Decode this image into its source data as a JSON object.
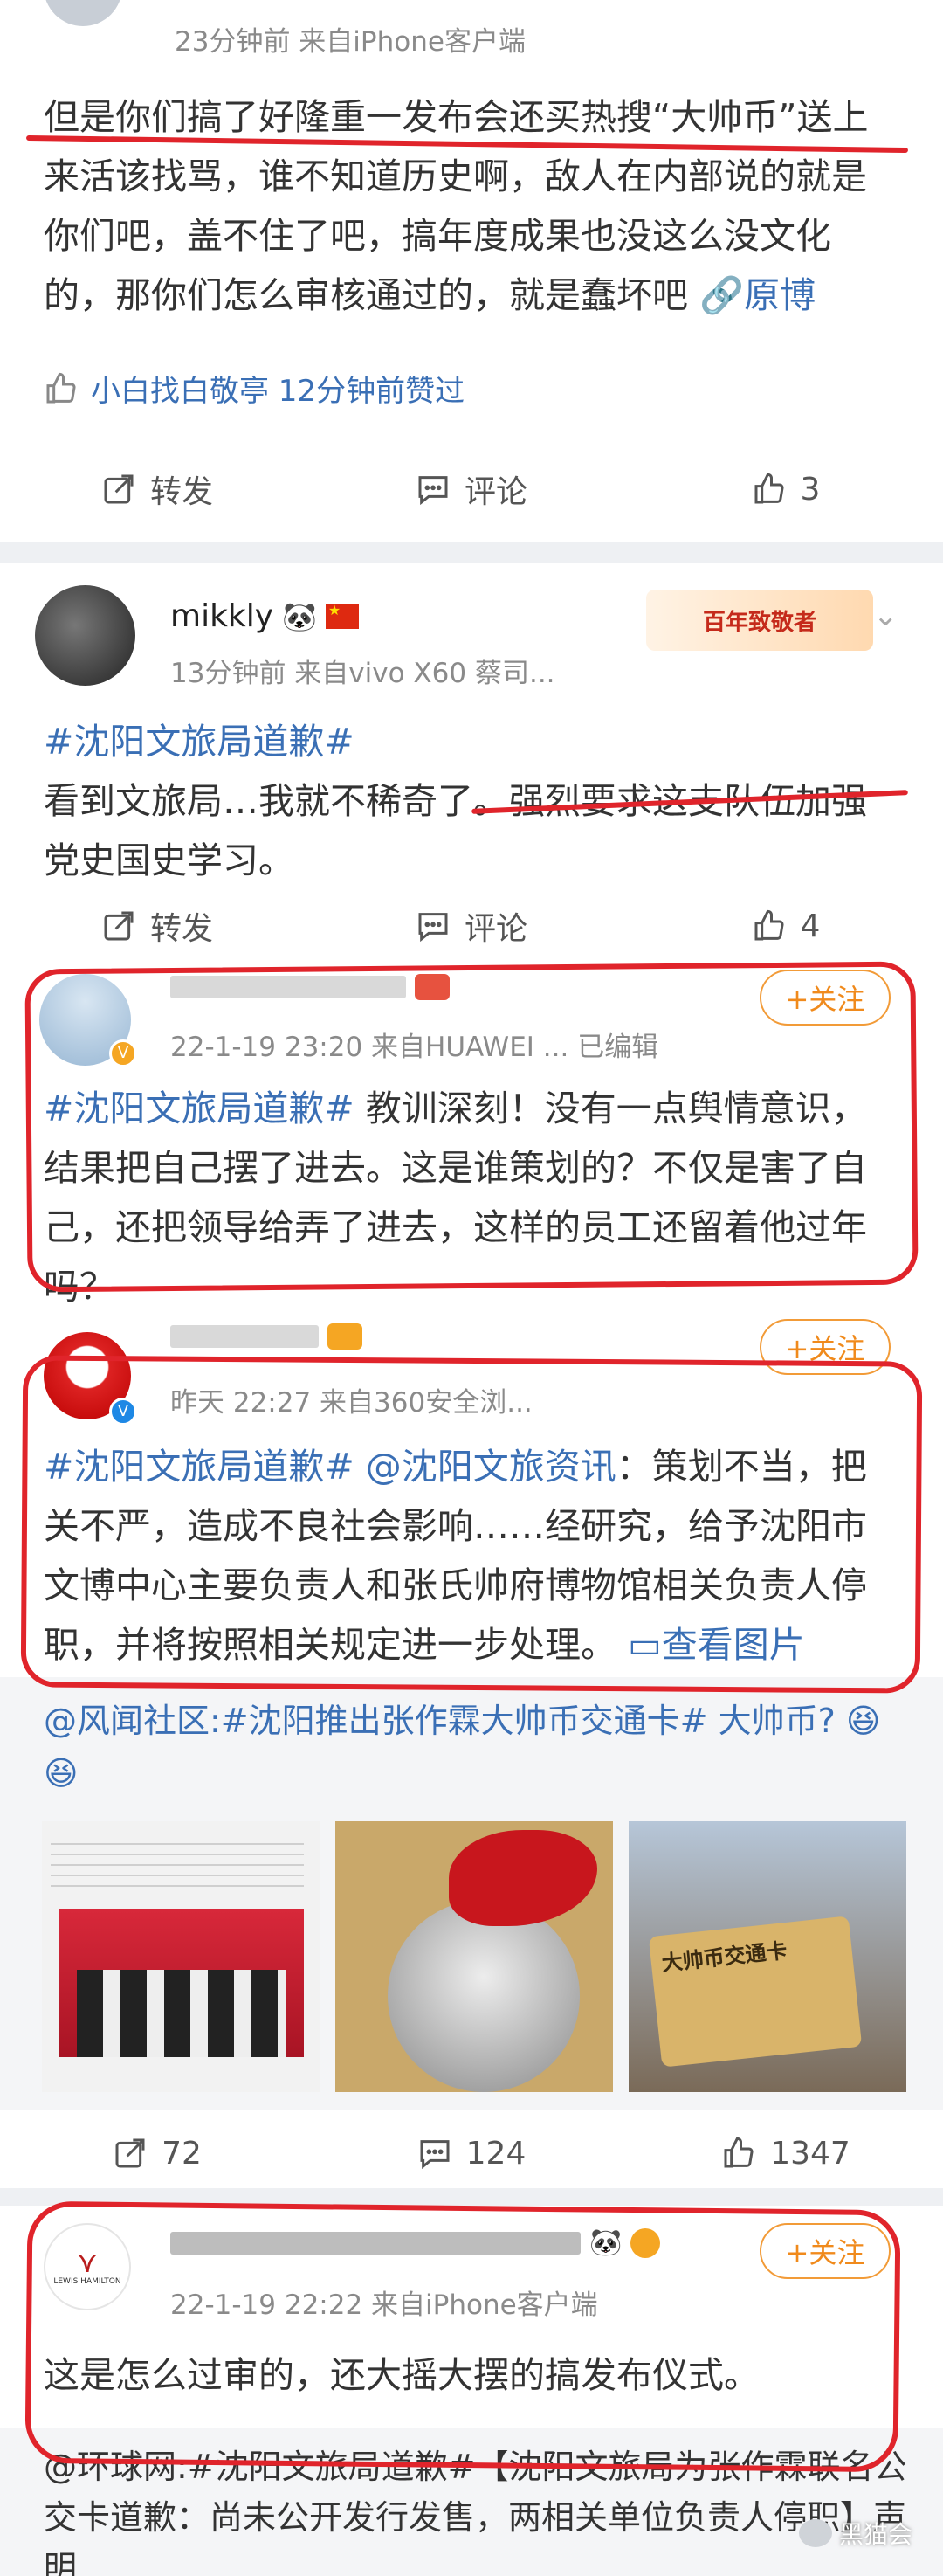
{
  "post1": {
    "meta": "23分钟前   来自iPhone客户端",
    "text_before": "但是你们搞了好隆重一发布会还买热搜“大帅币”送上来活该找骂，谁不知道历史啊，敌人在内部说的就是你们吧，盖不住了吧，搞年度成果也没这么没文化的，那你们怎么审核通过的，就是蠢坏吧",
    "link": "原博",
    "liked_by": "小白找白敬亭 12分钟前赞过",
    "actions": {
      "repost": "转发",
      "comment": "评论",
      "like": "3"
    }
  },
  "post2": {
    "username": "mikkly",
    "meta": "13分钟前   来自vivo X60 蔡司...",
    "topic": "#沈阳文旅局道歉#",
    "text": "看到文旅局…我就不稀奇了。强烈要求这支队伍加强党史国史学习。",
    "badge": "百年致敬者",
    "actions": {
      "repost": "转发",
      "comment": "评论",
      "like": "4"
    }
  },
  "post3": {
    "meta": "22-1-19 23:20   来自HUAWEI ...   已编辑",
    "topic": "#沈阳文旅局道歉#",
    "text": " 教训深刻！没有一点舆情意识，结果把自己摆了进去。这是谁策划的？不仅是害了自己，还把领导给弄了进去，这样的员工还留着他过年吗？",
    "follow": "+关注"
  },
  "post4": {
    "meta": "昨天 22:27   来自360安全浏...",
    "topic": "#沈阳文旅局道歉#",
    "mention": " @沈阳文旅资讯",
    "text": "：策划不当，把关不严，造成不良社会影响……经研究，给予沈阳市文博中心主要负责人和张氏帅府博物馆相关负责人停职，并将按照相关规定进一步处理。",
    "view_images": "查看图片",
    "follow": "+关注",
    "quote_text": "@风闻社区:#沈阳推出张作霖大帅币交通卡# 大帅币?",
    "thumb3_text": "大帅币交通卡",
    "actions": {
      "repost": "72",
      "comment": "124",
      "like": "1347"
    }
  },
  "post5": {
    "meta": "22-1-19 22:22   来自iPhone客户端",
    "text": "这是怎么过审的，还大摇大摆的搞发布仪式。",
    "follow": "+关注",
    "quote_text": "@环球网:#沈阳文旅局道歉#【沈阳文旅局为张作霖联名公交卡道歉：尚未公开发行发售，两相关单位负责人停职】声 明",
    "avatar_text": "LEWIS HAMILTON"
  },
  "watermark": "黑猫会",
  "colors": {
    "accent": "#3a6fb5",
    "highlight": "#e0242b",
    "follow": "#f29b38"
  }
}
